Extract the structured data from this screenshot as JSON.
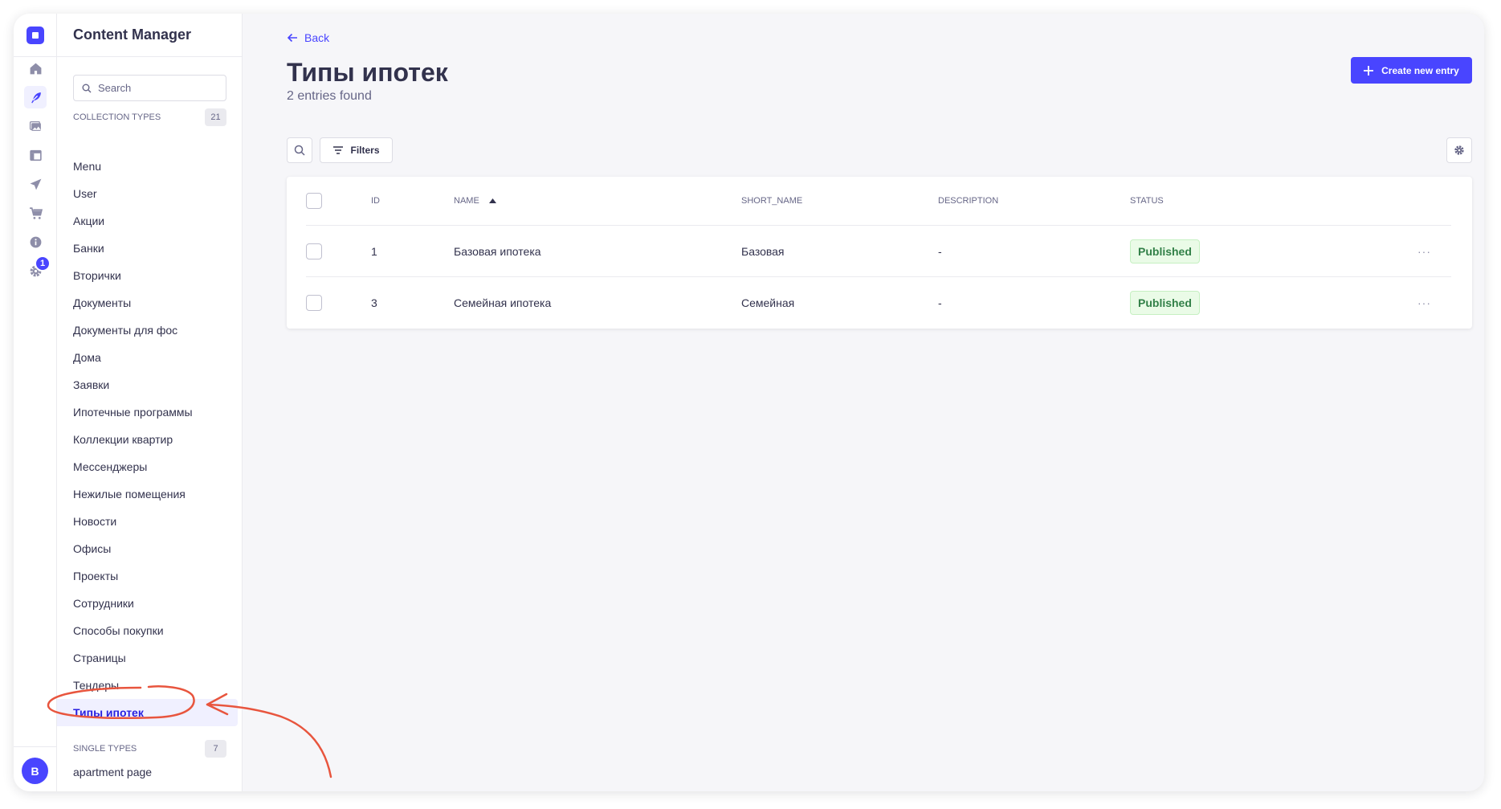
{
  "sidebar": {
    "title": "Content Manager",
    "search_placeholder": "Search",
    "collection_types_label": "COLLECTION TYPES",
    "collection_types_count": "21",
    "items": [
      {
        "label": "Menu"
      },
      {
        "label": "User"
      },
      {
        "label": "Акции"
      },
      {
        "label": "Банки"
      },
      {
        "label": "Вторички"
      },
      {
        "label": "Документы"
      },
      {
        "label": "Документы для фос"
      },
      {
        "label": "Дома"
      },
      {
        "label": "Заявки"
      },
      {
        "label": "Ипотечные программы"
      },
      {
        "label": "Коллекции квартир"
      },
      {
        "label": "Мессенджеры"
      },
      {
        "label": "Нежилые помещения"
      },
      {
        "label": "Новости"
      },
      {
        "label": "Офисы"
      },
      {
        "label": "Проекты"
      },
      {
        "label": "Сотрудники"
      },
      {
        "label": "Способы покупки"
      },
      {
        "label": "Страницы"
      },
      {
        "label": "Тендеры"
      },
      {
        "label": "Типы ипотек",
        "active": true
      }
    ],
    "single_types_label": "SINGLE TYPES",
    "single_types_count": "7",
    "single_items": [
      {
        "label": "apartment page"
      }
    ]
  },
  "rail": {
    "settings_badge": "1",
    "avatar_initial": "B",
    "icons": [
      "home-icon",
      "feather-icon",
      "media-library-icon",
      "layout-icon",
      "send-icon",
      "cart-icon",
      "info-icon",
      "settings-icon"
    ]
  },
  "header": {
    "back_label": "Back",
    "title": "Типы ипотек",
    "subtitle": "2 entries found",
    "create_label": "Create new entry"
  },
  "toolbar": {
    "filters_label": "Filters"
  },
  "table": {
    "columns": [
      "ID",
      "NAME",
      "SHORT_NAME",
      "DESCRIPTION",
      "STATUS"
    ],
    "rows": [
      {
        "id": "1",
        "name": "Базовая ипотека",
        "short_name": "Базовая",
        "description": "-",
        "status": "Published"
      },
      {
        "id": "3",
        "name": "Семейная ипотека",
        "short_name": "Семейная",
        "description": "-",
        "status": "Published"
      }
    ],
    "more_label": "···"
  },
  "colors": {
    "primary": "#4945ff",
    "annotation": "#e8553e",
    "success": "#328048",
    "success_bg": "#eafbe7"
  }
}
